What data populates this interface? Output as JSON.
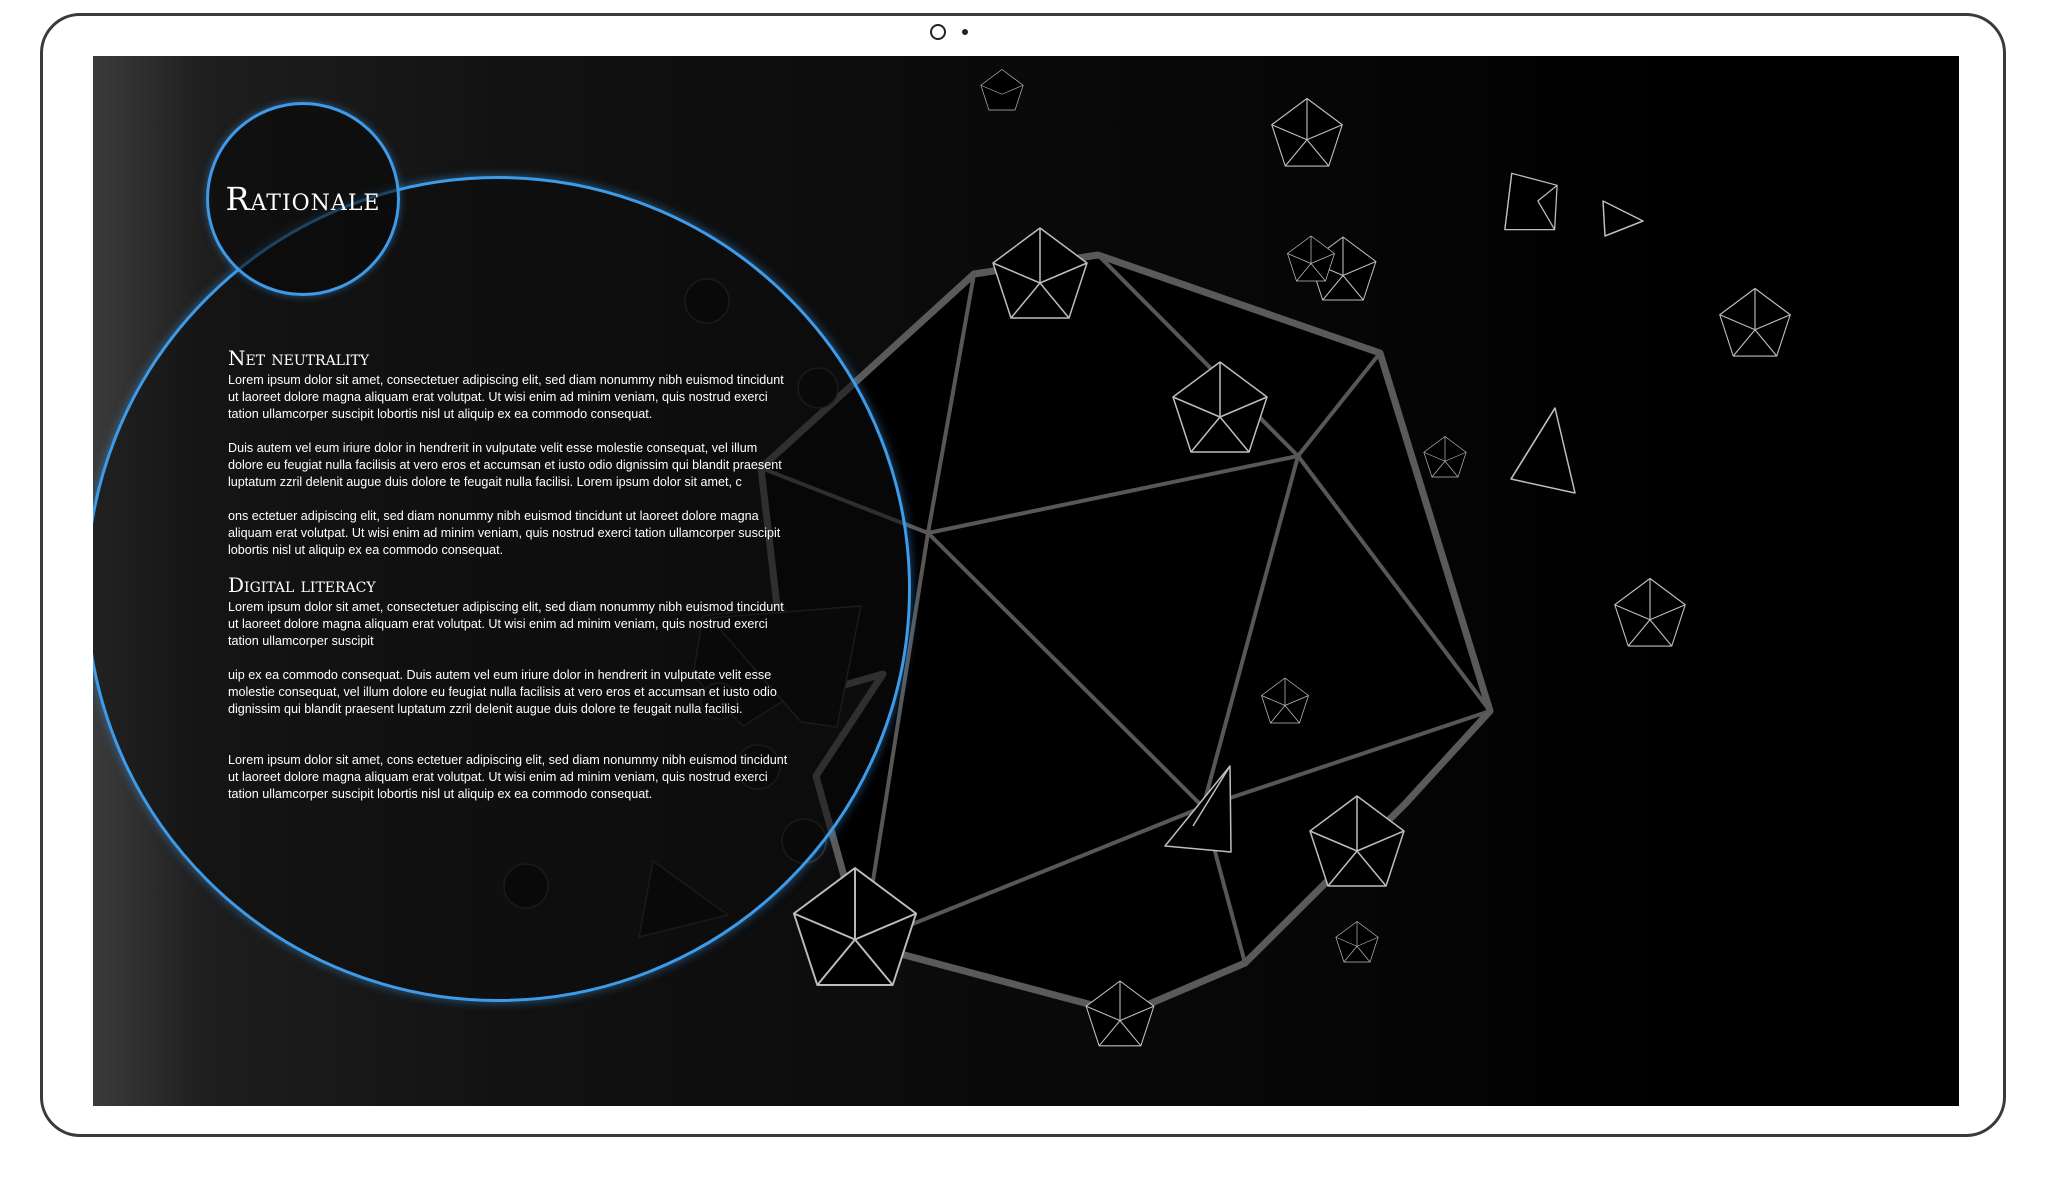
{
  "slide": {
    "title": "Rationale",
    "sections": [
      {
        "heading": "Net neutrality",
        "paragraphs": [
          "Lorem ipsum dolor sit amet, consectetuer adipiscing elit, sed diam nonummy nibh euismod tincidunt ut laoreet dolore magna aliquam erat volutpat. Ut wisi enim ad minim veniam, quis nostrud exerci tation ullamcorper suscipit lobortis nisl ut aliquip ex ea commodo consequat.",
          "Duis autem vel eum iriure dolor in hendrerit in vulputate velit esse molestie consequat, vel illum dolore eu feugiat nulla facilisis at vero eros et accumsan et iusto odio dignissim qui blandit praesent luptatum zzril delenit augue duis dolore te feugait nulla facilisi. Lorem ipsum dolor sit amet, c",
          "ons ectetuer adipiscing elit, sed diam nonummy nibh euismod tincidunt ut laoreet dolore magna aliquam erat volutpat. Ut wisi enim ad minim veniam, quis nostrud exerci tation ullamcorper suscipit lobortis nisl ut aliquip ex ea commodo consequat."
        ]
      },
      {
        "heading": "Digital literacy",
        "paragraphs": [
          "Lorem ipsum dolor sit amet, consectetuer adipiscing elit, sed diam nonummy nibh euismod tincidunt ut laoreet dolore magna aliquam erat volutpat. Ut wisi enim ad minim veniam, quis nostrud exerci tation ullamcorper suscipit",
          "uip ex ea commodo consequat. Duis autem vel eum iriure dolor in hendrerit in vulputate velit esse molestie consequat, vel illum dolore eu feugiat nulla facilisis at vero eros et accumsan et iusto odio dignissim qui blandit praesent luptatum zzril delenit augue duis dolore te feugait nulla facilisi.",
          "Lorem ipsum dolor sit amet, cons ectetuer adipiscing elit, sed diam nonummy nibh euismod tincidunt ut laoreet dolore magna aliquam erat volutpat. Ut wisi enim ad minim veniam, quis nostrud exerci tation ullamcorper suscipit lobortis nisl ut aliquip ex ea commodo consequat."
        ]
      }
    ]
  },
  "colors": {
    "accent": "#3d9be9",
    "wireframe": "#5a5a5a",
    "text": "#ffffff"
  }
}
